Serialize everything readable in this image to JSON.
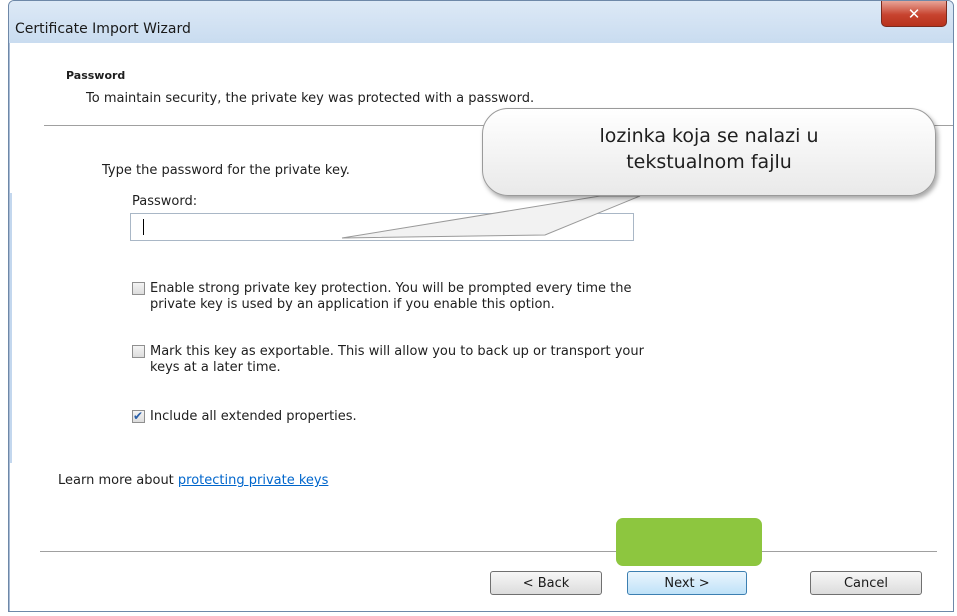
{
  "window": {
    "title": "Certificate Import Wizard",
    "close_glyph": "✕"
  },
  "page": {
    "heading": "Password",
    "subheading": "To maintain security, the private key was protected with a password."
  },
  "form": {
    "prompt": "Type the password for the private key.",
    "password_label": "Password:",
    "password_value": ""
  },
  "options": [
    {
      "line1": "Enable strong private key protection. You will be prompted every time the",
      "line2": "private key is used by an application if you enable this option.",
      "checked": false
    },
    {
      "line1": "Mark this key as exportable. This will allow you to back up or transport your",
      "line2": "keys at a later time.",
      "checked": false
    },
    {
      "line1": "Include all extended properties.",
      "line2": "",
      "checked": true
    }
  ],
  "learn_more": {
    "prefix": "Learn more about ",
    "link": "protecting private keys"
  },
  "buttons": {
    "back": "< Back",
    "next": "Next >",
    "cancel": "Cancel"
  },
  "annotation": {
    "line1": "lozinka koja se nalazi u",
    "line2": "tekstualnom fajlu",
    "highlight_color": "#8dc63f"
  }
}
